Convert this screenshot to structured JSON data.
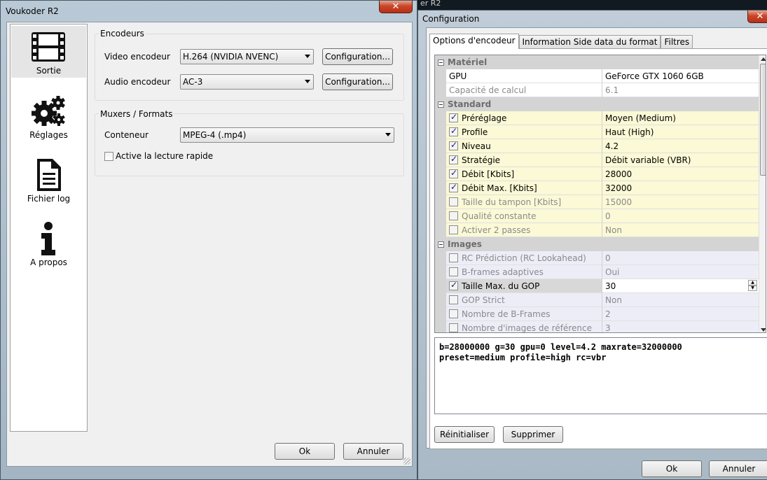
{
  "left_window": {
    "title": "Voukoder R2",
    "close_glyph": "✕",
    "nav": [
      {
        "label": "Sortie",
        "icon": "film-icon"
      },
      {
        "label": "Réglages",
        "icon": "gears-icon"
      },
      {
        "label": "Fichier log",
        "icon": "document-icon"
      },
      {
        "label": "A propos",
        "icon": "info-icon"
      }
    ],
    "encoders_group": {
      "title": "Encodeurs",
      "video_label": "Video encodeur",
      "video_value": "H.264 (NVIDIA NVENC)",
      "audio_label": "Audio encodeur",
      "audio_value": "AC-3",
      "config_label": "Configuration..."
    },
    "muxers_group": {
      "title": "Muxers / Formats",
      "container_label": "Conteneur",
      "container_value": "MPEG-4 (.mp4)",
      "fast_start_label": "Active la lecture rapide",
      "fast_start_checked": false
    },
    "ok_label": "Ok",
    "cancel_label": "Annuler"
  },
  "right_window": {
    "title": "Configuration",
    "close_glyph": "✕",
    "background_title_fragment": "er R2",
    "tabs": [
      "Options d'encodeur",
      "Information Side data du format",
      "Filtres"
    ],
    "grid": {
      "categories": {
        "materiel": "Matériel",
        "standard": "Standard",
        "images": "Images"
      },
      "materiel_rows": [
        {
          "name": "GPU",
          "value": "GeForce GTX 1060 6GB"
        },
        {
          "name": "Capacité de calcul",
          "value": "6.1"
        }
      ],
      "standard_rows": [
        {
          "name": "Préréglage",
          "value": "Moyen (Medium)",
          "checked": true
        },
        {
          "name": "Profile",
          "value": "Haut (High)",
          "checked": true
        },
        {
          "name": "Niveau",
          "value": "4.2",
          "checked": true
        },
        {
          "name": "Stratégie",
          "value": "Débit variable (VBR)",
          "checked": true
        },
        {
          "name": "Débit [Kbits]",
          "value": "28000",
          "checked": true
        },
        {
          "name": "Débit Max. [Kbits]",
          "value": "32000",
          "checked": true
        },
        {
          "name": "Taille du tampon [Kbits]",
          "value": "15000",
          "checked": false
        },
        {
          "name": "Qualité constante",
          "value": "0",
          "checked": false
        },
        {
          "name": "Activer 2 passes",
          "value": "Non",
          "checked": false
        }
      ],
      "images_rows": [
        {
          "name": "RC Prédiction (RC Lookahead)",
          "value": "0",
          "checked": false
        },
        {
          "name": "B-frames adaptives",
          "value": "Oui",
          "checked": false
        },
        {
          "name": "Taille Max. du GOP",
          "value": "30",
          "checked": true
        },
        {
          "name": "GOP Strict",
          "value": "Non",
          "checked": false
        },
        {
          "name": "Nombre de B-Frames",
          "value": "2",
          "checked": false
        },
        {
          "name": "Nombre d'images de référence",
          "value": "3",
          "checked": false
        }
      ]
    },
    "command_line": "b=28000000 g=30 gpu=0 level=4.2 maxrate=32000000\npreset=medium profile=high rc=vbr",
    "reset_label": "Réinitialiser",
    "delete_label": "Supprimer",
    "ok_label": "Ok",
    "cancel_label": "Annuler"
  }
}
